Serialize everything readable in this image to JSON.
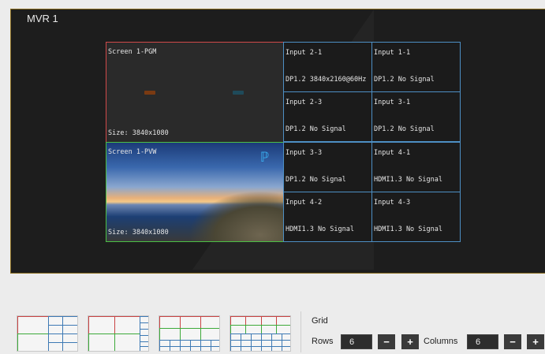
{
  "mvr": {
    "title": "MVR 1",
    "pgm": {
      "name": "Screen 1-PGM",
      "size": "Size: 3840x1080"
    },
    "pvw": {
      "name": "Screen 1-PVW",
      "size": "Size: 3840x1080"
    },
    "inputs": [
      {
        "name": "Input 2-1",
        "status": "DP1.2 3840x2160@60Hz"
      },
      {
        "name": "Input 1-1",
        "status": "DP1.2 No Signal"
      },
      {
        "name": "Input 2-3",
        "status": "DP1.2 No Signal"
      },
      {
        "name": "Input 3-1",
        "status": "DP1.2 No Signal"
      },
      {
        "name": "Input 3-3",
        "status": "DP1.2 No Signal"
      },
      {
        "name": "Input 4-1",
        "status": "HDMI1.3 No Signal"
      },
      {
        "name": "Input 4-2",
        "status": "HDMI1.3 No Signal"
      },
      {
        "name": "Input 4-3",
        "status": "HDMI1.3 No Signal"
      }
    ]
  },
  "grid": {
    "label": "Grid",
    "rows_label": "Rows",
    "rows_value": "6",
    "columns_label": "Columns",
    "columns_value": "6",
    "minus": "−",
    "plus": "+"
  },
  "colors": {
    "pgm_border": "#d04a4a",
    "pvw_border": "#4cbf45",
    "input_border": "#4d8fc4",
    "panel_border": "#8a6d1f"
  }
}
